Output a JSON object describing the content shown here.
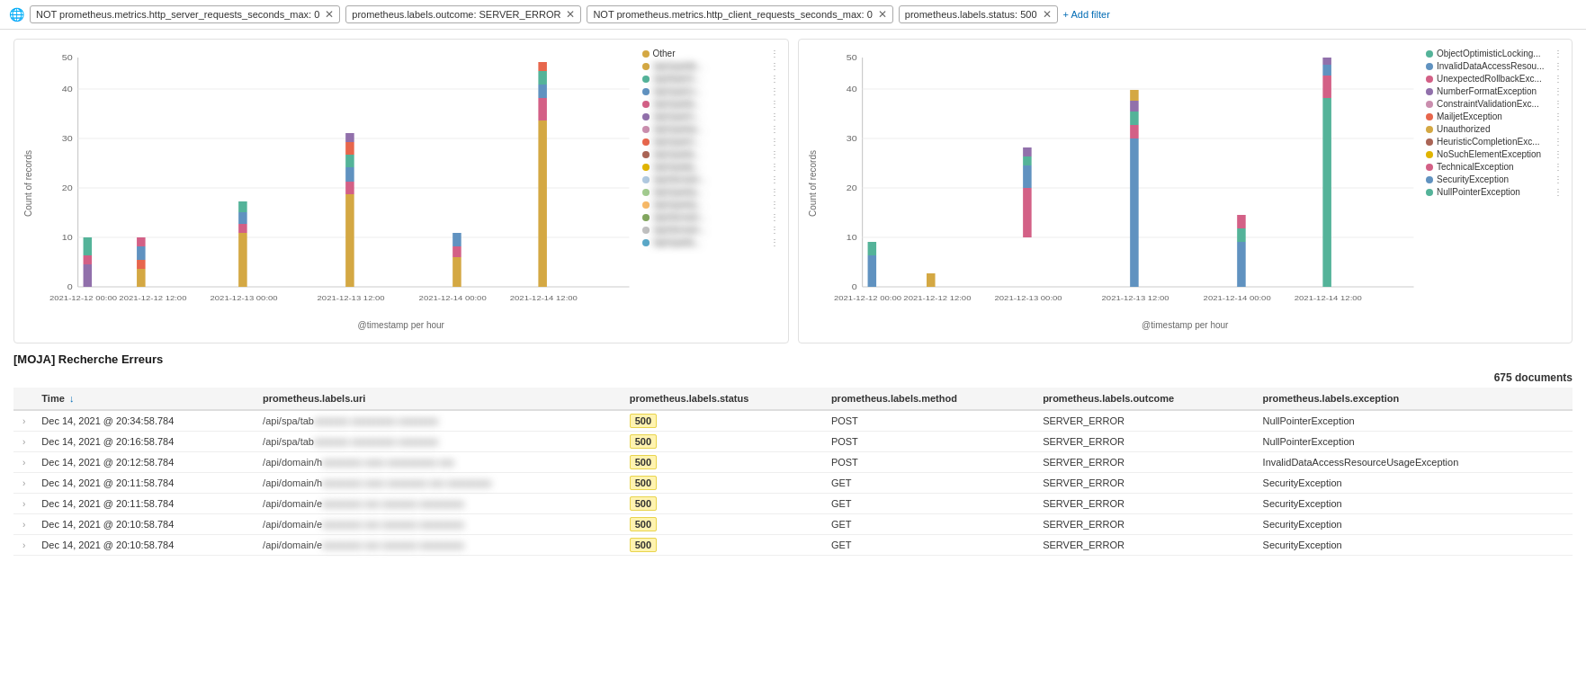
{
  "filterBar": {
    "globeIcon": "🌐",
    "filters": [
      {
        "id": "f1",
        "label": "NOT prometheus.metrics.http_server_requests_seconds_max: 0",
        "removable": true
      },
      {
        "id": "f2",
        "label": "prometheus.labels.outcome: SERVER_ERROR",
        "removable": true
      },
      {
        "id": "f3",
        "label": "NOT prometheus.metrics.http_client_requests_seconds_max: 0",
        "removable": true
      },
      {
        "id": "f4",
        "label": "prometheus.labels.status: 500",
        "removable": true
      }
    ],
    "addFilterLabel": "+ Add filter"
  },
  "charts": [
    {
      "id": "chart1",
      "yLabel": "Count of records",
      "xLabel": "@timestamp per hour",
      "legend": [
        {
          "label": "Other",
          "color": "#d4a843"
        },
        {
          "label": "/api/spa/de...",
          "color": "#d4a843"
        },
        {
          "label": "/api/batch/...",
          "color": "#54b399"
        },
        {
          "label": "/api/spa/cc...",
          "color": "#6092c0"
        },
        {
          "label": "/api/spa/ta...",
          "color": "#d36086"
        },
        {
          "label": "/api/spa/m...",
          "color": "#9170ab"
        },
        {
          "label": "/api/spa/ep...",
          "color": "#ca8eae"
        },
        {
          "label": "/api/spa/m...",
          "color": "#e7664c"
        },
        {
          "label": "/api/spa/ta...",
          "color": "#aa6556"
        },
        {
          "label": "/api/spa/ja...",
          "color": "#e0b400"
        },
        {
          "label": "/api/domain...",
          "color": "#b0c9e0"
        },
        {
          "label": "/api/spa/ep...",
          "color": "#a2cb8f"
        },
        {
          "label": "/api/spa/ep...",
          "color": "#f7b967"
        },
        {
          "label": "/api/domain...",
          "color": "#82a65e"
        },
        {
          "label": "/api/domain...",
          "color": "#c0c0c0"
        },
        {
          "label": "/api/spa/ta...",
          "color": "#5aa8c8"
        }
      ]
    },
    {
      "id": "chart2",
      "yLabel": "Count of records",
      "xLabel": "@timestamp per hour",
      "legend": [
        {
          "label": "ObjectOptimisticLocking...",
          "color": "#54b399"
        },
        {
          "label": "InvalidDataAccessResou...",
          "color": "#6092c0"
        },
        {
          "label": "UnexpectedRollbackExc...",
          "color": "#d36086"
        },
        {
          "label": "NumberFormatException",
          "color": "#9170ab"
        },
        {
          "label": "ConstraintValidationExc...",
          "color": "#ca8eae"
        },
        {
          "label": "MailjetException",
          "color": "#e7664c"
        },
        {
          "label": "Unauthorized",
          "color": "#d4a843"
        },
        {
          "label": "HeuristicCompletionExc...",
          "color": "#aa6556"
        },
        {
          "label": "NoSuchElementException",
          "color": "#e0b400"
        },
        {
          "label": "TechnicalException",
          "color": "#d36086"
        },
        {
          "label": "SecurityException",
          "color": "#6092c0"
        },
        {
          "label": "NullPointerException",
          "color": "#54b399"
        }
      ]
    }
  ],
  "table": {
    "title": "[MOJA] Recherche Erreurs",
    "docCount": "675 documents",
    "columns": [
      {
        "id": "time",
        "label": "Time",
        "sortable": true
      },
      {
        "id": "uri",
        "label": "prometheus.labels.uri"
      },
      {
        "id": "status",
        "label": "prometheus.labels.status"
      },
      {
        "id": "method",
        "label": "prometheus.labels.method"
      },
      {
        "id": "outcome",
        "label": "prometheus.labels.outcome"
      },
      {
        "id": "exception",
        "label": "prometheus.labels.exception"
      }
    ],
    "rows": [
      {
        "time": "Dec 14, 2021 @ 20:34:58.784",
        "uri": "/api/spa/tab",
        "uri_blurred": "xxxxxxx xxxxxxxxx xxxxxxxx",
        "status": "500",
        "method": "POST",
        "outcome": "SERVER_ERROR",
        "exception": "NullPointerException"
      },
      {
        "time": "Dec 14, 2021 @ 20:16:58.784",
        "uri": "/api/spa/tab",
        "uri_blurred": "xxxxxxx xxxxxxxxx xxxxxxxx",
        "status": "500",
        "method": "POST",
        "outcome": "SERVER_ERROR",
        "exception": "NullPointerException"
      },
      {
        "time": "Dec 14, 2021 @ 20:12:58.784",
        "uri": "/api/domain/h",
        "uri_blurred": "xxxxxxxx xxxx xxxxxxxxxx xxx",
        "status": "500",
        "method": "POST",
        "outcome": "SERVER_ERROR",
        "exception": "InvalidDataAccessResourceUsageException"
      },
      {
        "time": "Dec 14, 2021 @ 20:11:58.784",
        "uri": "/api/domain/h",
        "uri_blurred": "xxxxxxxx xxxx xxxxxxxx xxx xxxxxxxxx",
        "status": "500",
        "method": "GET",
        "outcome": "SERVER_ERROR",
        "exception": "SecurityException"
      },
      {
        "time": "Dec 14, 2021 @ 20:11:58.784",
        "uri": "/api/domain/e",
        "uri_blurred": "xxxxxxxx xxx xxxxxxx xxxxxxxxx",
        "status": "500",
        "method": "GET",
        "outcome": "SERVER_ERROR",
        "exception": "SecurityException"
      },
      {
        "time": "Dec 14, 2021 @ 20:10:58.784",
        "uri": "/api/domain/e",
        "uri_blurred": "xxxxxxxx xxx xxxxxxx xxxxxxxxx",
        "status": "500",
        "method": "GET",
        "outcome": "SERVER_ERROR",
        "exception": "SecurityException"
      },
      {
        "time": "Dec 14, 2021 @ 20:10:58.784",
        "uri": "/api/domain/e",
        "uri_blurred": "xxxxxxxx xxx xxxxxxx xxxxxxxxx",
        "status": "500",
        "method": "GET",
        "outcome": "SERVER_ERROR",
        "exception": "SecurityException"
      }
    ]
  }
}
